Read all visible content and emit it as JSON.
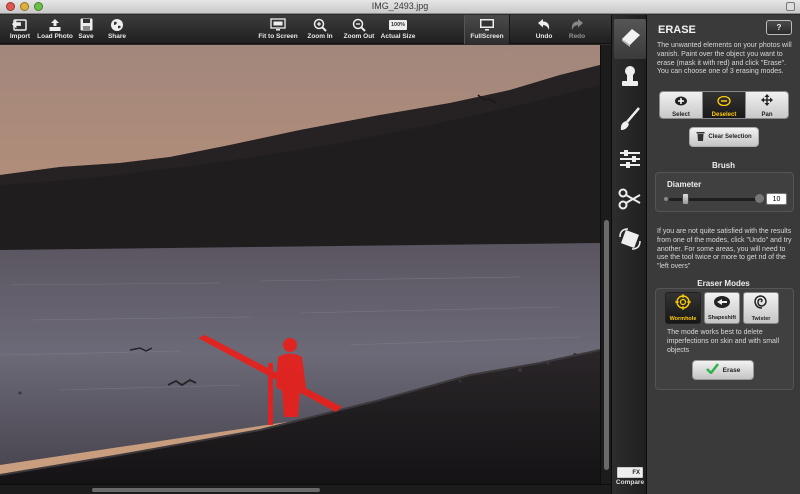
{
  "window": {
    "title": "IMG_2493.jpg"
  },
  "toolbar": {
    "import": "Import",
    "load_photo": "Load Photo",
    "save": "Save",
    "share": "Share",
    "fit_to_screen": "Fit to Screen",
    "zoom_in": "Zoom In",
    "zoom_out": "Zoom Out",
    "actual_size": "Actual Size",
    "actual_size_badge": "100%",
    "fullscreen": "FullScreen",
    "undo": "Undo",
    "redo": "Redo"
  },
  "toolstrip": {
    "tools": [
      "eraser-tool",
      "stamp-tool",
      "brush-tool",
      "adjust-tool",
      "crop-tool",
      "rotate-tool"
    ],
    "compare_label": "Compare",
    "compare_badge": "FX"
  },
  "panel": {
    "title": "ERASE",
    "help_label": "?",
    "intro": "The unwanted elements on your photos will vanish. Paint over the object you want to erase (mask it with red) and click \"Erase\". You can choose one of 3 erasing modes.",
    "selection_modes": [
      {
        "label": "Select",
        "icon": "select-icon"
      },
      {
        "label": "Deselect",
        "icon": "deselect-icon",
        "active": true
      },
      {
        "label": "Pan",
        "icon": "pan-icon"
      }
    ],
    "clear_selection": "Clear Selection",
    "brush_heading": "Brush",
    "diameter_label": "Diameter",
    "diameter_value": "10",
    "diameter_fraction": 0.15,
    "hint": "If you are not quite satisfied with the results from one of the modes, click \"Undo\" and try another. For some areas, you will need to use the tool twice or more to get rid of the \"left overs\"",
    "eraser_modes_heading": "Eraser Modes",
    "eraser_modes": [
      {
        "label": "Wormhole",
        "icon": "wormhole-icon",
        "active": true
      },
      {
        "label": "Shapeshift",
        "icon": "shapeshift-icon"
      },
      {
        "label": "Twister",
        "icon": "twister-icon"
      }
    ],
    "mode_note": "The mode works best to delete imperfections on skin and with small objects",
    "erase_button": "Erase"
  },
  "colors": {
    "mask_red": "#e8201c",
    "accent_yellow": "#ffcc00",
    "check_green": "#2fb34a"
  }
}
